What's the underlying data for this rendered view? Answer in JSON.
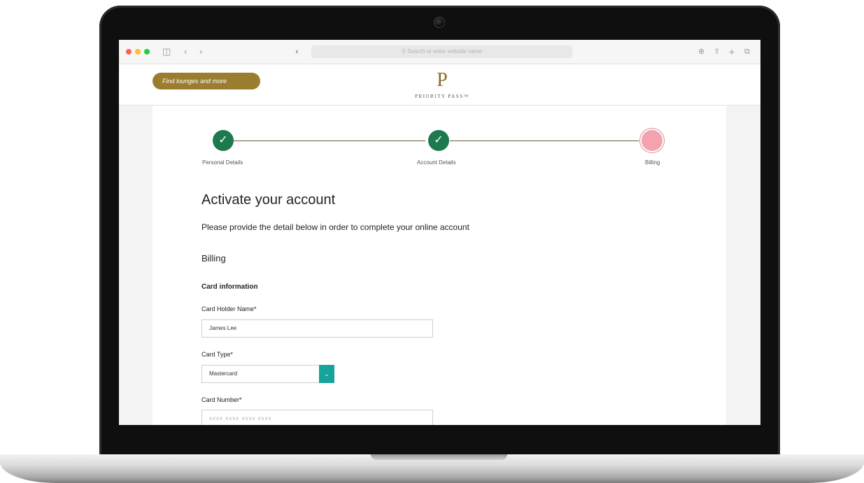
{
  "browser": {
    "address_placeholder": "Search or enter website name",
    "colors": {
      "red": "#ff5f57",
      "yellow": "#febc2e",
      "green": "#28c840"
    }
  },
  "header": {
    "find_button": "Find lounges and more",
    "logo_letter": "P",
    "logo_text": "PRIORITY PASS™"
  },
  "steps": [
    {
      "label": "Personal Details",
      "status": "complete",
      "icon": "check-icon"
    },
    {
      "label": "Account Details",
      "status": "complete",
      "icon": "check-icon"
    },
    {
      "label": "Billing",
      "status": "current",
      "icon": "none"
    }
  ],
  "form": {
    "title": "Activate your account",
    "subtitle": "Please provide the detail below in order to complete your online account",
    "section": "Billing",
    "subsection": "Card information",
    "card_holder": {
      "label": "Card Holder Name*",
      "value": "James Lee"
    },
    "card_type": {
      "label": "Card Type*",
      "value": "Mastercard"
    },
    "card_number": {
      "label": "Card Number*",
      "placeholder": "xxxx xxxx xxxx xxxx"
    }
  },
  "colors": {
    "gold": "#9a7d2e",
    "step_complete": "#1d7a4e",
    "step_current": "#f4a2af",
    "select_accent": "#18a39a"
  }
}
